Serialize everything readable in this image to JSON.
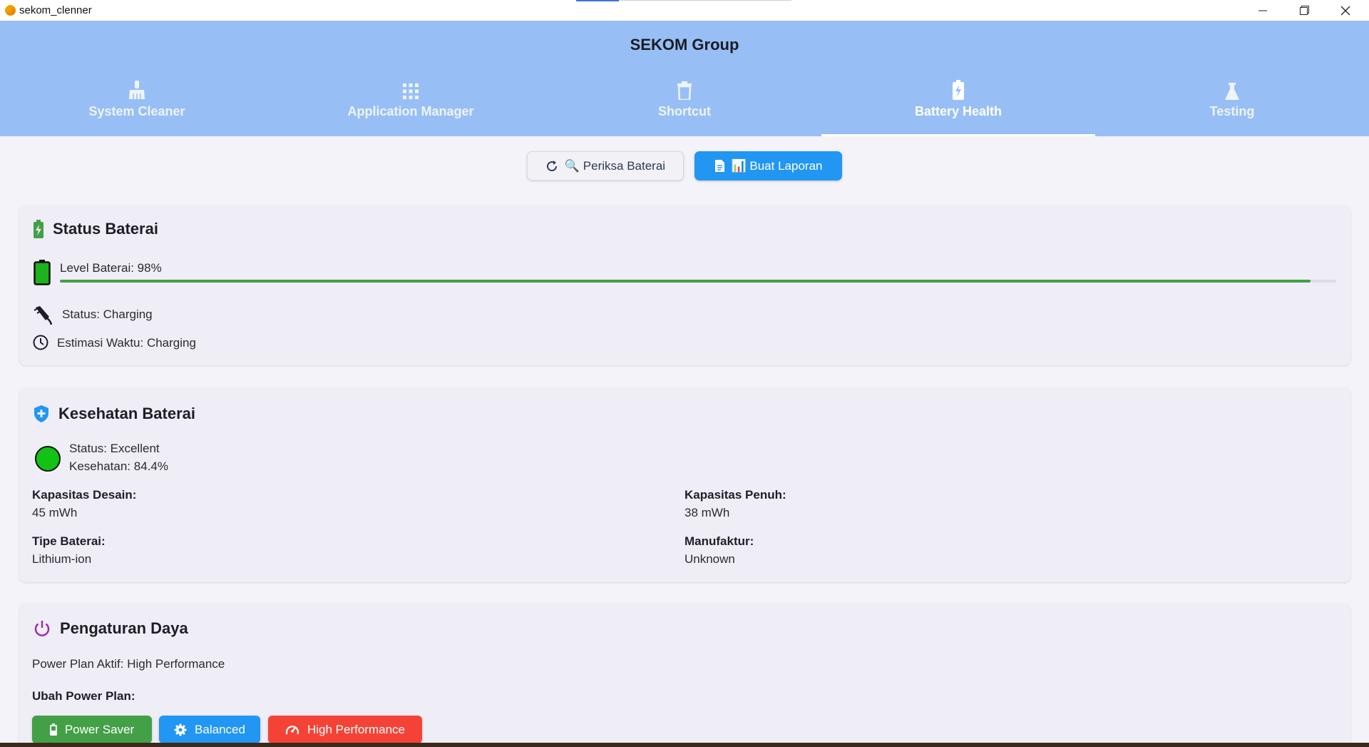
{
  "window": {
    "title": "sekom_clenner",
    "minimize_icon": "minimize-icon",
    "maximize_icon": "restore-icon",
    "close_icon": "close-icon"
  },
  "header": {
    "brand": "SEKOM Group",
    "background": "#98bff5"
  },
  "tabs": [
    {
      "label": "System Cleaner",
      "icon": "broom-icon",
      "active": false
    },
    {
      "label": "Application Manager",
      "icon": "apps-grid-icon",
      "active": false
    },
    {
      "label": "Shortcut",
      "icon": "trash-icon",
      "active": false
    },
    {
      "label": "Battery Health",
      "icon": "battery-charging-icon",
      "active": true
    },
    {
      "label": "Testing",
      "icon": "flask-icon",
      "active": false
    }
  ],
  "actions": {
    "check_label": "🔍 Periksa Baterai",
    "report_label": "📊 Buat Laporan",
    "accent": "#2196f3"
  },
  "status_card": {
    "title": "Status Baterai",
    "level_text": "Level Baterai: 98%",
    "level_fraction": 0.98,
    "status_text": "Status: Charging",
    "estimate_text": "Estimasi Waktu: Charging",
    "progress_color": "#43a047"
  },
  "health_card": {
    "title": "Kesehatan Baterai",
    "status_text": "Status: Excellent",
    "health_text": "Kesehatan: 84.4%",
    "indicator_color": "#12c214",
    "design_capacity_label": "Kapasitas Desain:",
    "design_capacity_value": "45 mWh",
    "full_capacity_label": "Kapasitas Penuh:",
    "full_capacity_value": "38 mWh",
    "type_label": "Tipe Baterai:",
    "type_value": "Lithium-ion",
    "manufacturer_label": "Manufaktur:",
    "manufacturer_value": "Unknown"
  },
  "power_card": {
    "title": "Pengaturan Daya",
    "active_plan_text": "Power Plan Aktif: High Performance",
    "change_label": "Ubah Power Plan:",
    "buttons": [
      {
        "label": "Power Saver",
        "color": "#43a047",
        "icon": "battery-icon"
      },
      {
        "label": "Balanced",
        "color": "#2196f3",
        "icon": "gear-icon"
      },
      {
        "label": "High Performance",
        "color": "#f44336",
        "icon": "speedometer-icon"
      }
    ]
  }
}
